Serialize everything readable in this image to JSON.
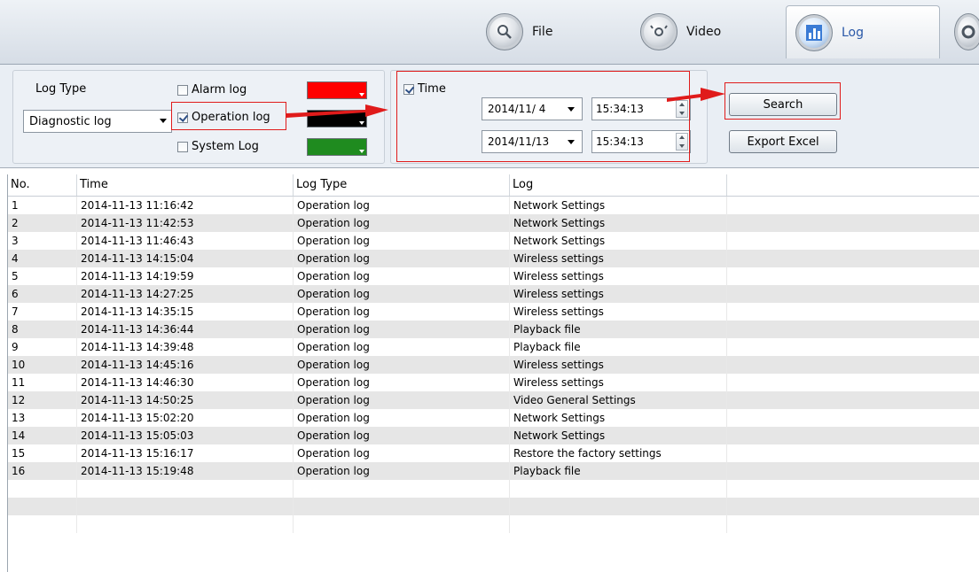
{
  "nav": {
    "tabs": [
      {
        "label": "File",
        "icon": "file-icon",
        "active": false
      },
      {
        "label": "Video",
        "icon": "video-icon",
        "active": false
      },
      {
        "label": "Log",
        "icon": "log-icon",
        "active": true
      },
      {
        "label": "",
        "icon": "settings-icon",
        "active": false
      }
    ]
  },
  "filters": {
    "log_type_label": "Log Type",
    "log_type_selected": "Diagnostic log",
    "checkboxes": [
      {
        "label": "Alarm log",
        "checked": false,
        "color": "#ff0000"
      },
      {
        "label": "Operation log",
        "checked": true,
        "color": "#000000"
      },
      {
        "label": "System Log",
        "checked": false,
        "color": "#1f8b1f"
      }
    ],
    "time": {
      "label": "Time",
      "checked": true,
      "start_date": "2014/11/ 4",
      "start_time": "15:34:13",
      "end_date": "2014/11/13",
      "end_time": "15:34:13"
    },
    "search_label": "Search",
    "export_label": "Export Excel"
  },
  "table": {
    "headers": [
      "No.",
      "Time",
      "Log Type",
      "Log"
    ],
    "rows": [
      [
        "1",
        "2014-11-13 11:16:42",
        "Operation log",
        "Network Settings"
      ],
      [
        "2",
        "2014-11-13 11:42:53",
        "Operation log",
        "Network Settings"
      ],
      [
        "3",
        "2014-11-13 11:46:43",
        "Operation log",
        "Network Settings"
      ],
      [
        "4",
        "2014-11-13 14:15:04",
        "Operation log",
        "Wireless settings"
      ],
      [
        "5",
        "2014-11-13 14:19:59",
        "Operation log",
        "Wireless settings"
      ],
      [
        "6",
        "2014-11-13 14:27:25",
        "Operation log",
        "Wireless settings"
      ],
      [
        "7",
        "2014-11-13 14:35:15",
        "Operation log",
        "Wireless settings"
      ],
      [
        "8",
        "2014-11-13 14:36:44",
        "Operation log",
        "Playback file"
      ],
      [
        "9",
        "2014-11-13 14:39:48",
        "Operation log",
        "Playback file"
      ],
      [
        "10",
        "2014-11-13 14:45:16",
        "Operation log",
        "Wireless settings"
      ],
      [
        "11",
        "2014-11-13 14:46:30",
        "Operation log",
        "Wireless settings"
      ],
      [
        "12",
        "2014-11-13 14:50:25",
        "Operation log",
        "Video General Settings"
      ],
      [
        "13",
        "2014-11-13 15:02:20",
        "Operation log",
        "Network Settings"
      ],
      [
        "14",
        "2014-11-13 15:05:03",
        "Operation log",
        "Network Settings"
      ],
      [
        "15",
        "2014-11-13 15:16:17",
        "Operation log",
        "Restore the factory settings"
      ],
      [
        "16",
        "2014-11-13 15:19:48",
        "Operation log",
        "Playback file"
      ]
    ],
    "empty_rows": 3
  },
  "annotations": {
    "highlight_color": "#e01b1b"
  }
}
